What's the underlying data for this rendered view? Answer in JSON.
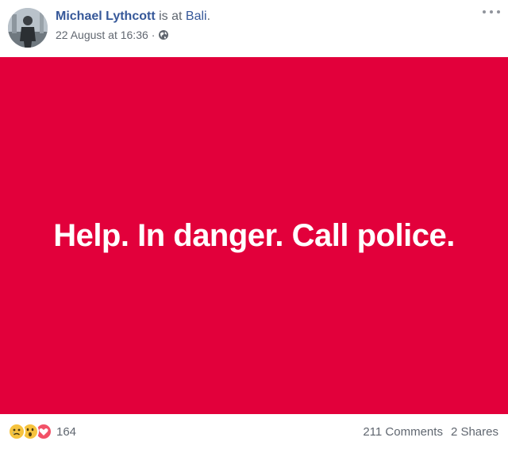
{
  "post": {
    "author": "Michael Lythcott",
    "connector": "is at",
    "location": "Bali",
    "location_suffix": ".",
    "timestamp": "22 August at 16:36",
    "separator": "·",
    "privacy_icon": "globe-icon",
    "menu_icon": "more-options-icon"
  },
  "status": {
    "text": "Help. In danger. Call police.",
    "background_color": "#e2003b",
    "text_color": "#ffffff"
  },
  "footer": {
    "reactions": [
      "sad-reaction-icon",
      "wow-reaction-icon",
      "love-reaction-icon"
    ],
    "reaction_count": "164",
    "comments": "211 Comments",
    "shares": "2 Shares"
  },
  "colors": {
    "link": "#365899",
    "meta": "#616770"
  }
}
